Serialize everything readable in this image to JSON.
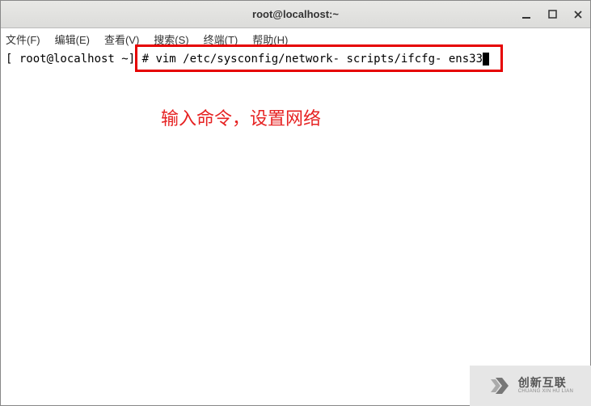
{
  "titlebar": {
    "title": "root@localhost:~"
  },
  "menubar": {
    "file": "文件(F)",
    "edit": "编辑(E)",
    "view": "查看(V)",
    "search": "搜索(S)",
    "terminal": "终端(T)",
    "help": "帮助(H)"
  },
  "terminal": {
    "prompt": "[ root@localhost ~] # ",
    "command": "vim /etc/sysconfig/network- scripts/ifcfg- ens33"
  },
  "annotation": {
    "text": "输入命令，设置网络"
  },
  "watermark": {
    "main": "创新互联",
    "sub": "CHUANG XIN HU LIAN"
  }
}
